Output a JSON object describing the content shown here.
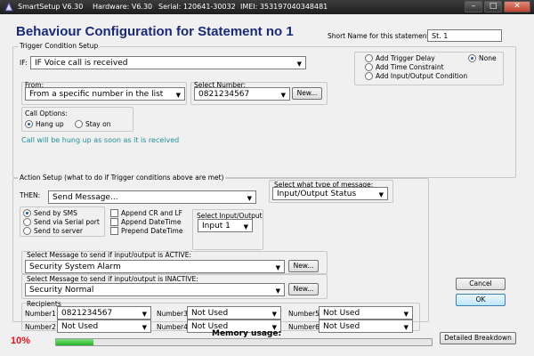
{
  "titlebar": {
    "app": "SmartSetup V6.30",
    "hardware": "Hardware: V6.30",
    "serial": "Serial: 120641-30032",
    "imei": "IMEI: 353197040348481"
  },
  "heading": "Behaviour Configuration for Statement no 1",
  "short_name": {
    "label": "Short Name for this statement:",
    "value": "St. 1"
  },
  "trigger": {
    "title": "Trigger Condition Setup",
    "if_label": "IF:",
    "if_value": "IF Voice call is received",
    "options": [
      {
        "label": "Add Trigger Delay",
        "selected": false
      },
      {
        "label": "Add Time Constraint",
        "selected": false
      },
      {
        "label": "Add Input/Output Condition",
        "selected": false
      },
      {
        "label": "None",
        "selected": true
      }
    ],
    "from": {
      "title": "From:",
      "value": "From a specific number in the list"
    },
    "select_number": {
      "title": "Select Number:",
      "value": "0821234567",
      "new_label": "New..."
    },
    "call_options": {
      "title": "Call Options:",
      "options": [
        {
          "label": "Hang up",
          "selected": true
        },
        {
          "label": "Stay on",
          "selected": false
        }
      ]
    },
    "info": "Call will be hung up as soon as it is received"
  },
  "action": {
    "title": "Action Setup (what to do if Trigger conditions above are met)",
    "then_label": "THEN:",
    "then_value": "Send Message...",
    "message_type": {
      "title": "Select what type of message:",
      "value": "Input/Output Status"
    },
    "send_via": [
      {
        "label": "Send by SMS",
        "selected": true
      },
      {
        "label": "Send via Serial port",
        "selected": false
      },
      {
        "label": "Send to server",
        "selected": false
      }
    ],
    "append": [
      {
        "label": "Append CR and LF",
        "checked": false
      },
      {
        "label": "Append DateTime",
        "checked": false
      },
      {
        "label": "Prepend DateTime",
        "checked": false
      }
    ],
    "input_output": {
      "title": "Select Input/Output",
      "value": "Input 1"
    },
    "active": {
      "title": "Select Message to send if input/output is ACTIVE:",
      "value": "Security System Alarm",
      "new_label": "New..."
    },
    "inactive": {
      "title": "Select Message to send if input/output is INACTIVE:",
      "value": "Security Normal",
      "new_label": "New..."
    },
    "recipients": {
      "title": "Recipients",
      "list": [
        {
          "label": "Number1",
          "value": "0821234567"
        },
        {
          "label": "Number3",
          "value": "Not Used"
        },
        {
          "label": "Number5",
          "value": "Not Used"
        },
        {
          "label": "Number2",
          "value": "Not Used"
        },
        {
          "label": "Number4",
          "value": "Not Used"
        },
        {
          "label": "Number6",
          "value": "Not Used"
        }
      ]
    }
  },
  "buttons": {
    "cancel": "Cancel",
    "ok": "OK",
    "detailed": "Detailed Breakdown"
  },
  "memory": {
    "label": "Memory usage:",
    "percent_text": "10%",
    "percent": 10
  }
}
